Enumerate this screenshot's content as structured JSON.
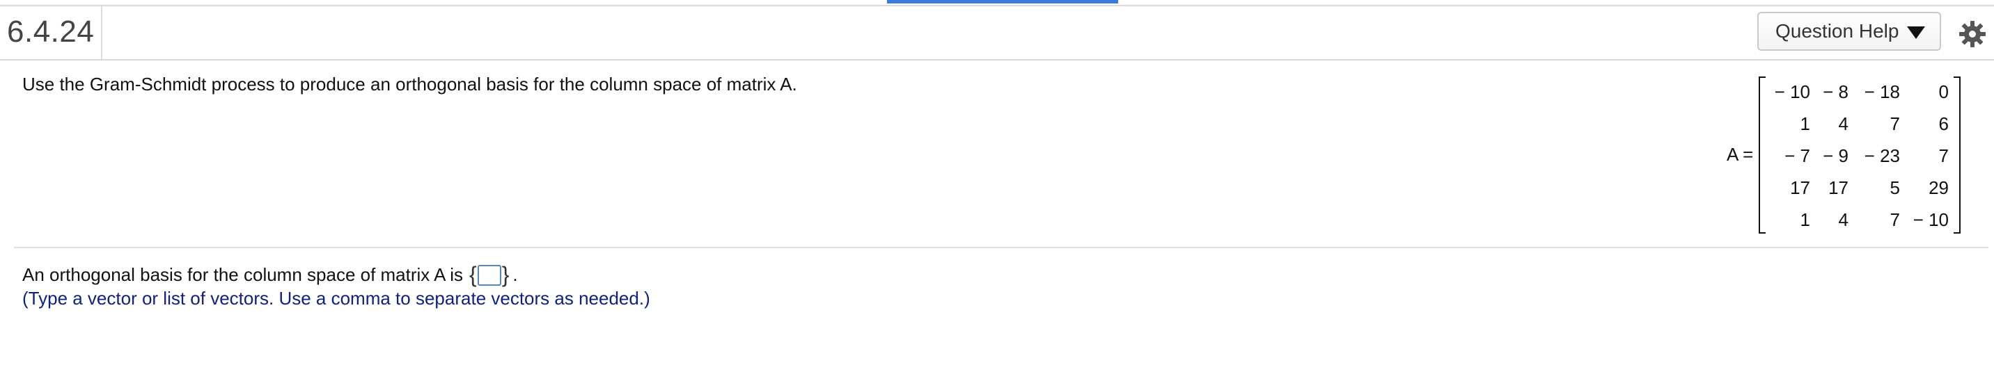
{
  "header": {
    "question_number": "6.4.24",
    "help_label": "Question Help",
    "help_icon": "caret-down-icon",
    "settings_icon": "gear-icon"
  },
  "question": {
    "prompt": "Use the Gram-Schmidt process to produce an orthogonal basis for the column space of matrix A."
  },
  "matrix": {
    "label": "A =",
    "rows": [
      [
        "− 10",
        "− 8",
        "− 18",
        "0"
      ],
      [
        "1",
        "4",
        "7",
        "6"
      ],
      [
        "− 7",
        "− 9",
        "− 23",
        "7"
      ],
      [
        "17",
        "17",
        "5",
        "29"
      ],
      [
        "1",
        "4",
        "7",
        "− 10"
      ]
    ]
  },
  "answer": {
    "prefix": "An orthogonal basis for the column space of matrix A is",
    "open_brace": "{",
    "close_brace": "}",
    "suffix": ".",
    "input_value": "",
    "hint": "(Type a vector or list of vectors. Use a comma to separate vectors as needed.)"
  },
  "colors": {
    "accent": "#3b7ad8",
    "hint_text": "#12217c",
    "input_border": "#5a86b8"
  }
}
